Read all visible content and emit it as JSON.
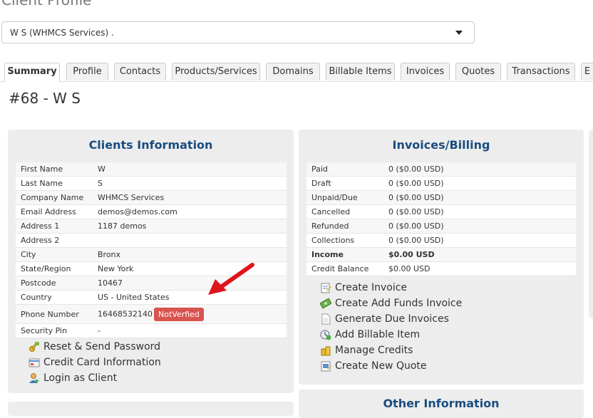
{
  "page_title": "Client Profile",
  "client_selector": {
    "value": "W S (WHMCS Services) ."
  },
  "tabs": [
    {
      "label": "Summary",
      "active": true
    },
    {
      "label": "Profile"
    },
    {
      "label": "Contacts"
    },
    {
      "label": "Products/Services"
    },
    {
      "label": "Domains"
    },
    {
      "label": "Billable Items"
    },
    {
      "label": "Invoices"
    },
    {
      "label": "Quotes"
    },
    {
      "label": "Transactions"
    },
    {
      "label": "E"
    }
  ],
  "client_heading": "#68 - W S",
  "clients_info": {
    "title": "Clients Information",
    "rows": [
      {
        "label": "First Name",
        "value": "W"
      },
      {
        "label": "Last Name",
        "value": "S"
      },
      {
        "label": "Company Name",
        "value": "WHMCS Services"
      },
      {
        "label": "Email Address",
        "value": "demos@demos.com"
      },
      {
        "label": "Address 1",
        "value": "1187 demos"
      },
      {
        "label": "Address 2",
        "value": ""
      },
      {
        "label": "City",
        "value": "Bronx"
      },
      {
        "label": "State/Region",
        "value": "New York"
      },
      {
        "label": "Postcode",
        "value": "10467"
      },
      {
        "label": "Country",
        "value": "US - United States"
      },
      {
        "label": "Phone Number",
        "value": "16468532140",
        "badge": "NotVerfied"
      },
      {
        "label": "Security Pin",
        "value": "-"
      }
    ],
    "actions": [
      {
        "label": "Reset & Send Password",
        "icon": "key-icon"
      },
      {
        "label": "Credit Card Information",
        "icon": "credit-card-icon"
      },
      {
        "label": "Login as Client",
        "icon": "user-login-icon"
      }
    ]
  },
  "billing": {
    "title": "Invoices/Billing",
    "rows": [
      {
        "label": "Paid",
        "value": "0 ($0.00 USD)"
      },
      {
        "label": "Draft",
        "value": "0 ($0.00 USD)"
      },
      {
        "label": "Unpaid/Due",
        "value": "0 ($0.00 USD)"
      },
      {
        "label": "Cancelled",
        "value": "0 ($0.00 USD)"
      },
      {
        "label": "Refunded",
        "value": "0 ($0.00 USD)"
      },
      {
        "label": "Collections",
        "value": "0 ($0.00 USD)"
      },
      {
        "label": "Income",
        "value": "$0.00 USD",
        "bold": true
      },
      {
        "label": "Credit Balance",
        "value": "$0.00 USD"
      }
    ],
    "actions": [
      {
        "label": "Create Invoice",
        "icon": "invoice-icon"
      },
      {
        "label": "Create Add Funds Invoice",
        "icon": "money-icon"
      },
      {
        "label": "Generate Due Invoices",
        "icon": "document-icon"
      },
      {
        "label": "Add Billable Item",
        "icon": "clock-add-icon"
      },
      {
        "label": "Manage Credits",
        "icon": "coins-icon"
      },
      {
        "label": "Create New Quote",
        "icon": "quote-icon"
      }
    ]
  },
  "other_info": {
    "title": "Other Information"
  },
  "colors": {
    "panel_title": "#1a4d80",
    "badge": "#d9534f",
    "arrow": "#e0141c",
    "panel_bg": "#ededed"
  }
}
